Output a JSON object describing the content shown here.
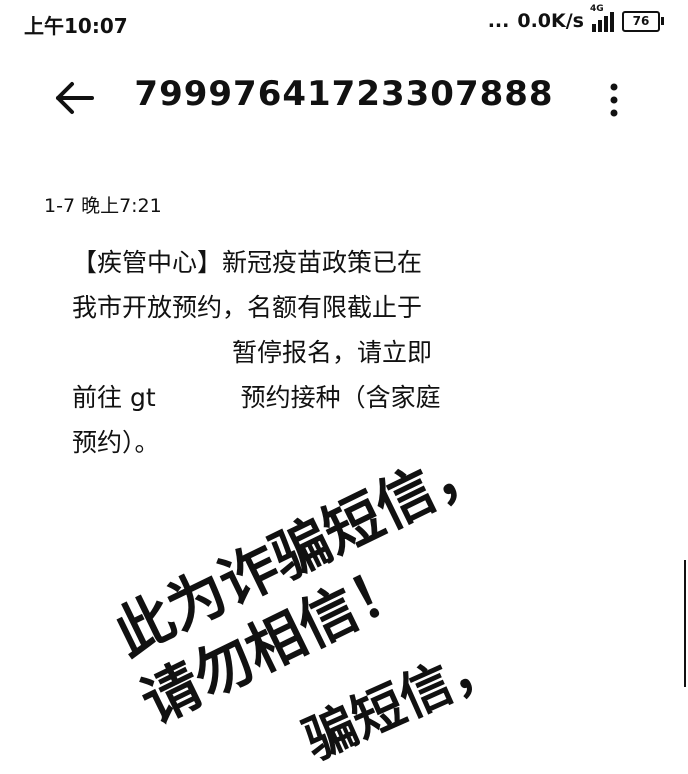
{
  "status_bar": {
    "time": "上午10:07",
    "dots": "...",
    "net_speed": "0.0K/s",
    "network_type": "4G",
    "battery_level": "76",
    "icons": [
      "signal-icon",
      "battery-icon"
    ]
  },
  "header": {
    "back_icon": "arrow-left-icon",
    "title": "79997641723307888",
    "more_icon": "more-vertical-icon"
  },
  "message": {
    "timestamp": "1-7 晚上7:21",
    "line1": "【疾管中心】新冠疫苗政策已在",
    "line2": "我市开放预约，名额有限截止于",
    "line3_visible": "暂停报名，请立即",
    "line4_prefix": "前往 gt",
    "line4_suffix": "预约接种（含家庭",
    "line5": "预约）。"
  },
  "overlay": {
    "warning_line1": "此为诈骗短信，",
    "warning_line2": "请勿相信！",
    "warning_line3": "骗短信，"
  }
}
